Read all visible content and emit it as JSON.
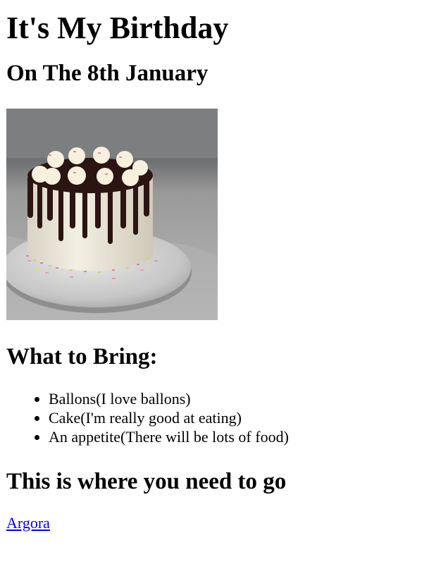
{
  "page": {
    "title": "It's My Birthday",
    "date_heading": "On The 8th January",
    "image_subject": "birthday-cake-photo",
    "bring_heading": "What to Bring:",
    "bring_items": [
      "Ballons(I love ballons)",
      "Cake(I'm really good at eating)",
      "An appetite(There will be lots of food)"
    ],
    "where_heading": "This is where you need to go",
    "location_link": "Argora"
  },
  "colors": {
    "link": "#0000ee",
    "text": "#000000",
    "background": "#ffffff"
  }
}
